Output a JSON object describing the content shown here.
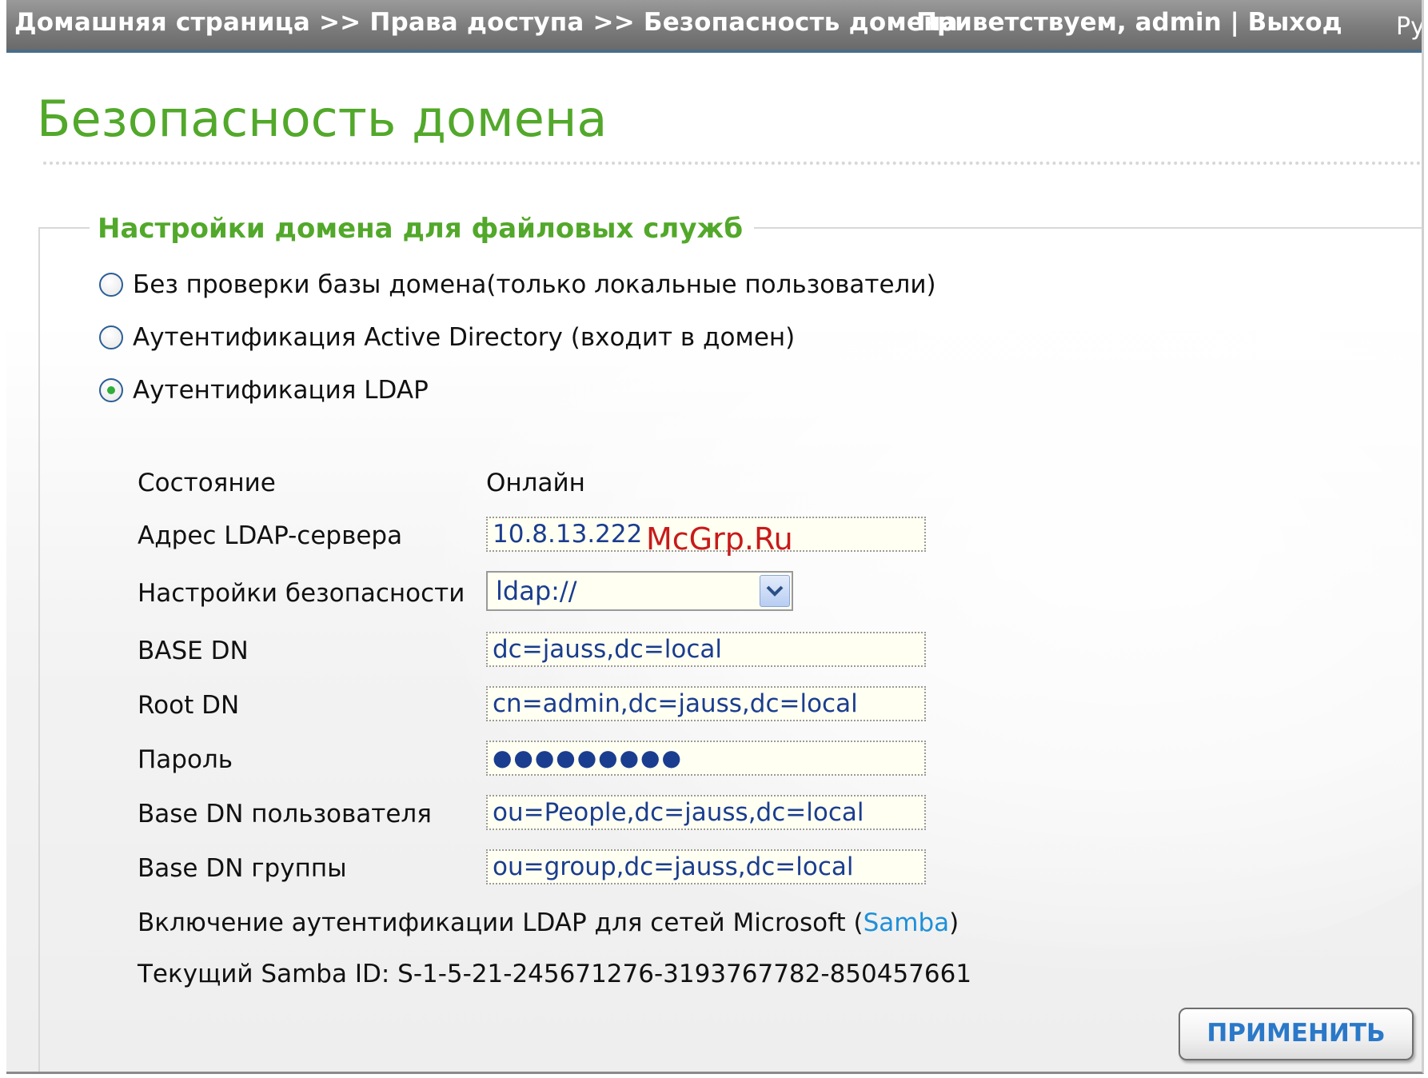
{
  "header": {
    "breadcrumb": "Домашняя страница >> Права доступа >> Безопасность домена",
    "welcome_prefix": "Приветствуем, ",
    "user": "admin",
    "separator": " | ",
    "logout": "Выход",
    "language": "Ру"
  },
  "page_title": "Безопасность домена",
  "section": {
    "legend": "Настройки домена для файловых служб",
    "options": [
      {
        "label": "Без проверки базы домена(только локальные пользователи)",
        "checked": false
      },
      {
        "label": "Аутентификация Active Directory (входит в домен)",
        "checked": false
      },
      {
        "label": "Аутентификация LDAP",
        "checked": true
      }
    ]
  },
  "ldap": {
    "status_label": "Состояние",
    "status_value": "Онлайн",
    "server_label": "Адрес LDAP-сервера",
    "server_value": "10.8.13.222",
    "security_label": "Настройки безопасности",
    "security_value": "ldap://",
    "base_dn_label": "BASE DN",
    "base_dn_value": "dc=jauss,dc=local",
    "root_dn_label": "Root DN",
    "root_dn_value": "cn=admin,dc=jauss,dc=local",
    "password_label": "Пароль",
    "password_value": "●●●●●●●●●",
    "user_base_dn_label": "Base DN пользователя",
    "user_base_dn_value": "ou=People,dc=jauss,dc=local",
    "group_base_dn_label": "Base DN группы",
    "group_base_dn_value": "ou=group,dc=jauss,dc=local",
    "samba_enable_prefix": "Включение аутентификации LDAP для сетей Microsoft (",
    "samba_link": "Samba",
    "samba_enable_suffix": ")",
    "samba_id": "Текущий Samba ID: S-1-5-21-245671276-3193767782-850457661"
  },
  "watermark": "McGrp.Ru",
  "apply_label": "ПРИМЕНИТЬ",
  "colors": {
    "title_green": "#52a82a",
    "field_text": "#1a3d8f",
    "link_blue": "#1e90d8",
    "button_text": "#2a78c8"
  }
}
